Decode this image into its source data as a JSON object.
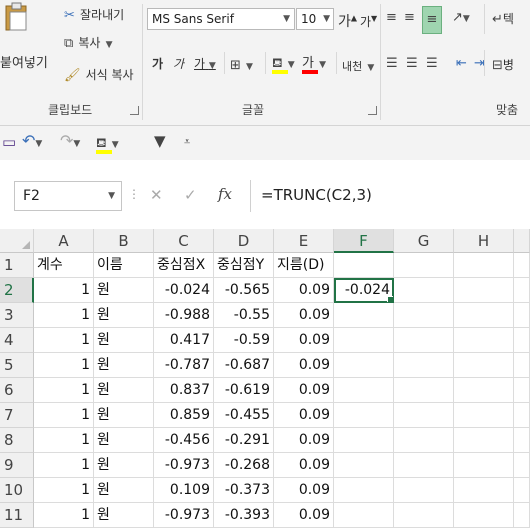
{
  "ribbon": {
    "clipboard": {
      "paste_label": "붙여넣기",
      "cut_label": "잘라내기",
      "copy_label": "복사",
      "format_painter_label": "서식 복사",
      "group_label": "클립보드"
    },
    "font": {
      "font_name": "MS Sans Serif",
      "font_size": "10",
      "grow_label": "가",
      "shrink_label": "가",
      "bold_label": "가",
      "italic_label": "가",
      "underline_label": "가",
      "font_color_label": "가",
      "phonetic_label": "내천",
      "group_label": "글꼴"
    },
    "alignment": {
      "group_label": "맞춤",
      "wrap_label": "텍",
      "merge_label": "병"
    }
  },
  "formula_bar": {
    "name_box": "F2",
    "fx_label": "fx",
    "formula": "=TRUNC(C2,3)"
  },
  "sheet": {
    "columns": [
      "A",
      "B",
      "C",
      "D",
      "E",
      "F",
      "G",
      "H"
    ],
    "selected_column": "F",
    "selected_row": "2",
    "rows": [
      {
        "num": "1",
        "A": "계수",
        "B": "이름",
        "C": "중심점X",
        "D": "중심점Y",
        "E": "지름(D)",
        "F": ""
      },
      {
        "num": "2",
        "A": "1",
        "B": "원",
        "C": "-0.024",
        "D": "-0.565",
        "E": "0.09",
        "F": "-0.024"
      },
      {
        "num": "3",
        "A": "1",
        "B": "원",
        "C": "-0.988",
        "D": "-0.55",
        "E": "0.09",
        "F": ""
      },
      {
        "num": "4",
        "A": "1",
        "B": "원",
        "C": "0.417",
        "D": "-0.59",
        "E": "0.09",
        "F": ""
      },
      {
        "num": "5",
        "A": "1",
        "B": "원",
        "C": "-0.787",
        "D": "-0.687",
        "E": "0.09",
        "F": ""
      },
      {
        "num": "6",
        "A": "1",
        "B": "원",
        "C": "0.837",
        "D": "-0.619",
        "E": "0.09",
        "F": ""
      },
      {
        "num": "7",
        "A": "1",
        "B": "원",
        "C": "0.859",
        "D": "-0.455",
        "E": "0.09",
        "F": ""
      },
      {
        "num": "8",
        "A": "1",
        "B": "원",
        "C": "-0.456",
        "D": "-0.291",
        "E": "0.09",
        "F": ""
      },
      {
        "num": "9",
        "A": "1",
        "B": "원",
        "C": "-0.973",
        "D": "-0.268",
        "E": "0.09",
        "F": ""
      },
      {
        "num": "10",
        "A": "1",
        "B": "원",
        "C": "0.109",
        "D": "-0.373",
        "E": "0.09",
        "F": ""
      },
      {
        "num": "11",
        "A": "1",
        "B": "원",
        "C": "-0.973",
        "D": "-0.393",
        "E": "0.09",
        "F": ""
      }
    ]
  },
  "colors": {
    "accent_green": "#217346",
    "highlight_yellow": "#ffff00",
    "font_red": "#ff0000",
    "fill_green_active": "#9fd5b0"
  }
}
